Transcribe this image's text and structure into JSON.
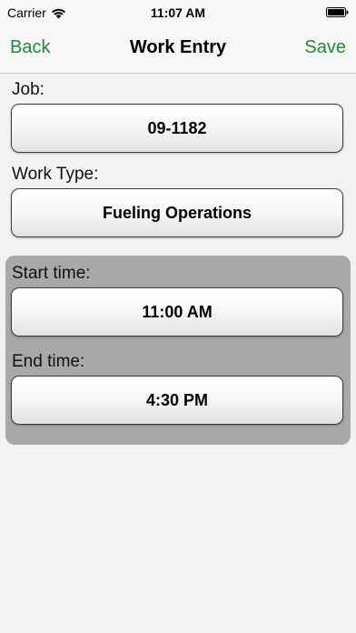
{
  "status_bar": {
    "carrier": "Carrier",
    "time": "11:07 AM"
  },
  "nav": {
    "back_label": "Back",
    "title": "Work Entry",
    "save_label": "Save"
  },
  "form": {
    "job_label": "Job:",
    "job_value": "09-1182",
    "work_type_label": "Work Type:",
    "work_type_value": "Fueling Operations",
    "start_time_label": "Start time:",
    "start_time_value": "11:00 AM",
    "end_time_label": "End time:",
    "end_time_value": "4:30 PM"
  },
  "colors": {
    "accent": "#1f8a3b",
    "background": "#f2f2f2",
    "time_panel": "#a8a8a8"
  },
  "icons": [
    "wifi-icon",
    "battery-icon"
  ]
}
